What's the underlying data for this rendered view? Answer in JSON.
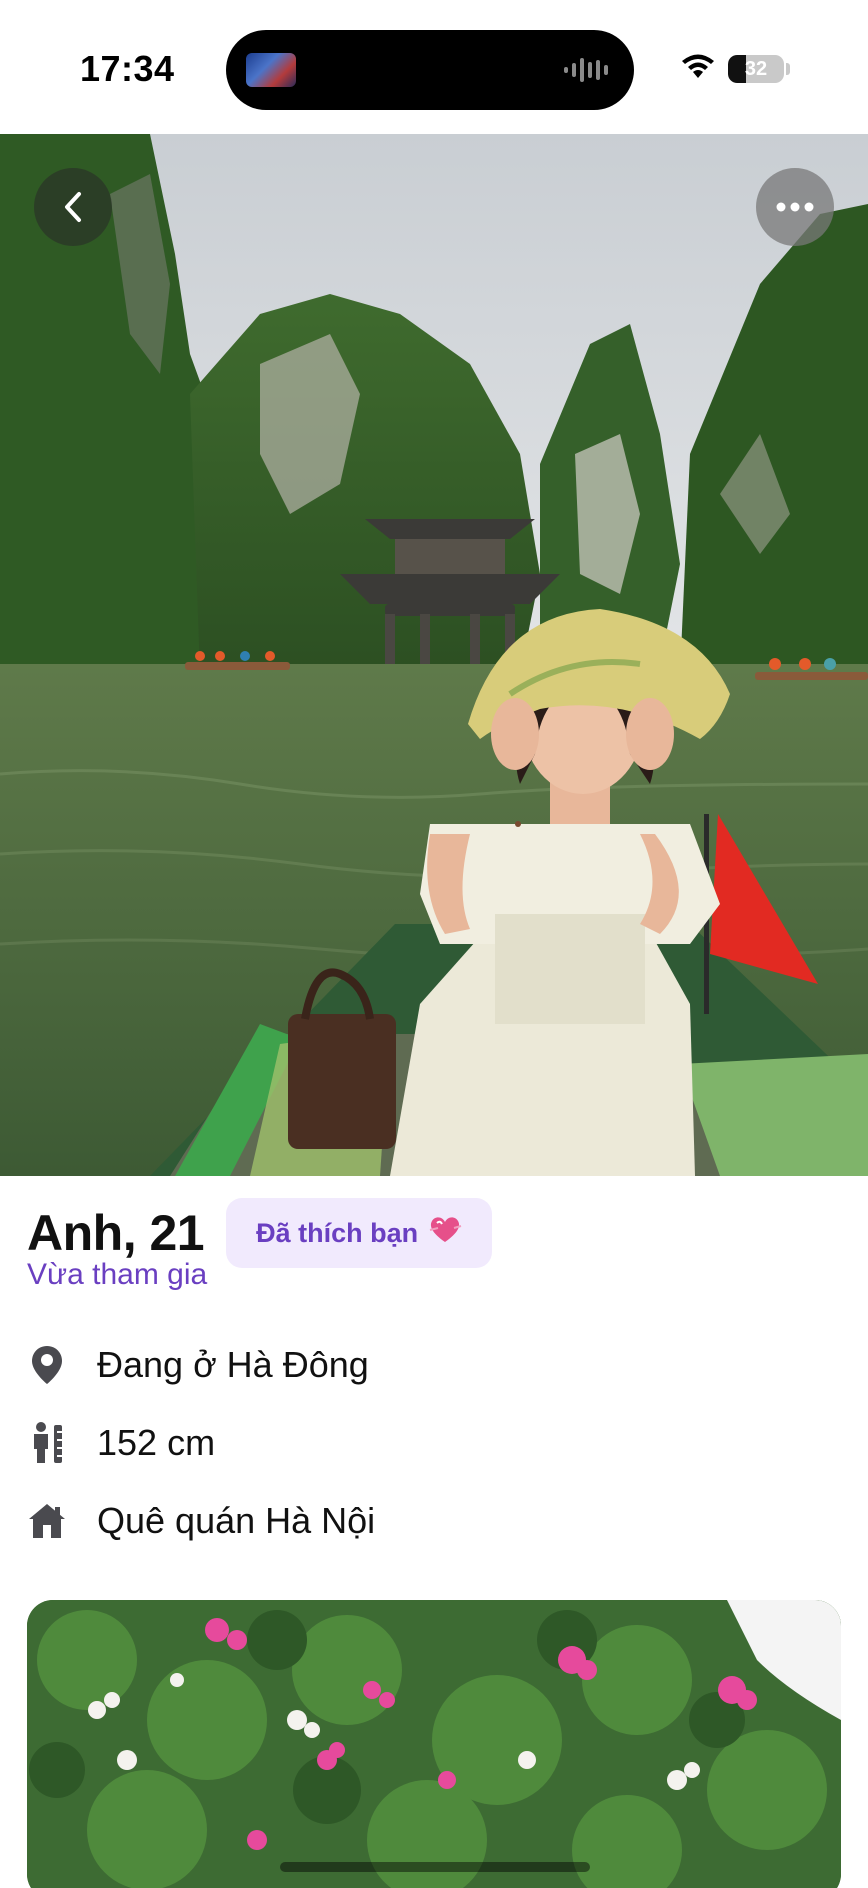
{
  "status_bar": {
    "time": "17:34",
    "battery_level": "32",
    "battery_fraction": 0.32,
    "icons": [
      "wifi-icon",
      "battery-icon",
      "audio-wave-icon"
    ]
  },
  "header": {
    "back_icon": "chevron-left-icon",
    "more_icon": "more-horizontal-icon"
  },
  "profile": {
    "name_age": "Anh, 21",
    "liked_badge": "Đã thích bạn",
    "liked_badge_icon": "heart-icon",
    "joined_status": "Vừa tham gia",
    "details": [
      {
        "icon": "location-pin-icon",
        "text": "Đang ở Hà Đông"
      },
      {
        "icon": "height-icon",
        "text": "152 cm"
      },
      {
        "icon": "home-icon",
        "text": "Quê quán Hà Nội"
      }
    ]
  },
  "colors": {
    "accent_purple": "#6a3fc1",
    "badge_bg": "#f1eafd",
    "heart_pink": "#e0457a",
    "icon_gray": "#4a4a4f"
  }
}
